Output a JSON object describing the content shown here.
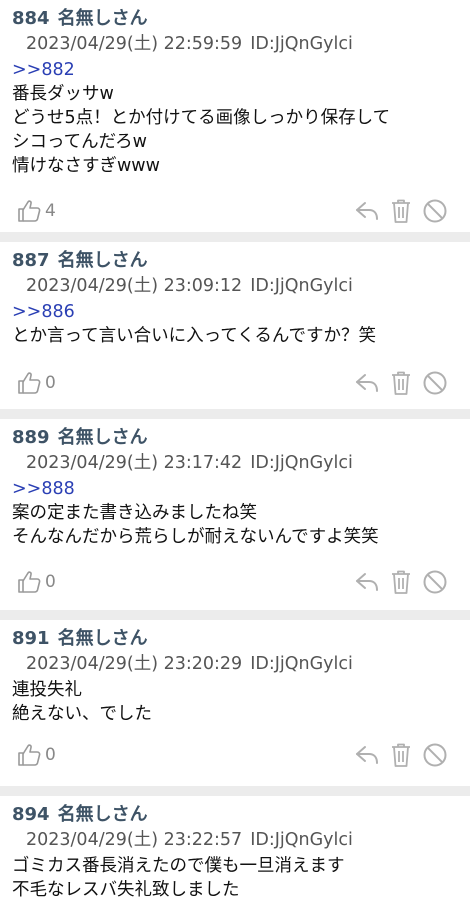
{
  "posts": [
    {
      "number": "884",
      "name": "名無しさん",
      "datetime": "2023/04/29(土) 22:59:59",
      "id": "ID:JjQnGylci",
      "anchor": ">>882",
      "lines": [
        "番長ダッサw",
        "どうせ5点！とか付けてる画像しっかり保存して",
        "シコってんだろw",
        "情けなさすぎwww"
      ],
      "likes": "4"
    },
    {
      "number": "887",
      "name": "名無しさん",
      "datetime": "2023/04/29(土) 23:09:12",
      "id": "ID:JjQnGylci",
      "anchor": ">>886",
      "lines": [
        "とか言って言い合いに入ってくるんですか？笑"
      ],
      "likes": "0"
    },
    {
      "number": "889",
      "name": "名無しさん",
      "datetime": "2023/04/29(土) 23:17:42",
      "id": "ID:JjQnGylci",
      "anchor": ">>888",
      "lines": [
        "案の定また書き込みましたね笑",
        "そんなんだから荒らしが耐えないんですよ笑笑"
      ],
      "likes": "0"
    },
    {
      "number": "891",
      "name": "名無しさん",
      "datetime": "2023/04/29(土) 23:20:29",
      "id": "ID:JjQnGylci",
      "anchor": "",
      "lines": [
        "連投失礼",
        "絶えない、でした"
      ],
      "likes": "0"
    },
    {
      "number": "894",
      "name": "名無しさん",
      "datetime": "2023/04/29(土) 23:22:57",
      "id": "ID:JjQnGylci",
      "anchor": "",
      "lines": [
        "ゴミカス番長消えたので僕も一旦消えます",
        "不毛なレスバ失礼致しました"
      ],
      "likes": ""
    }
  ],
  "icons": {
    "like": "thumbs-up-icon",
    "reply": "reply-arrow-icon",
    "delete": "trash-icon",
    "block": "block-icon"
  }
}
